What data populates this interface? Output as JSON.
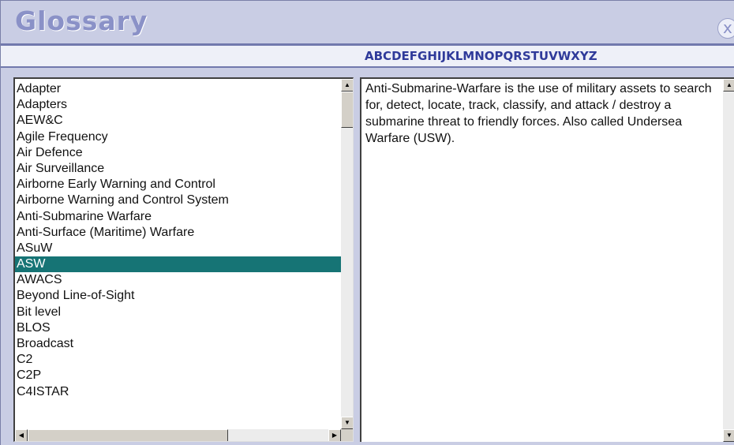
{
  "window": {
    "title": "Glossary",
    "close_glyph": "x",
    "accent_color": "#2f3a9a",
    "selected_color": "#167475"
  },
  "alphabet": [
    "A",
    "B",
    "C",
    "D",
    "E",
    "F",
    "G",
    "H",
    "I",
    "J",
    "K",
    "L",
    "M",
    "N",
    "O",
    "P",
    "Q",
    "R",
    "S",
    "T",
    "U",
    "V",
    "W",
    "X",
    "Y",
    "Z"
  ],
  "terms": [
    "Adapter",
    "Adapters",
    "AEW&C",
    "Agile Frequency",
    "Air Defence",
    "Air Surveillance",
    "Airborne Early Warning and Control",
    "Airborne Warning and Control System",
    "Anti-Submarine Warfare",
    "Anti-Surface (Maritime) Warfare",
    "ASuW",
    "ASW",
    "AWACS",
    "Beyond Line-of-Sight",
    "Bit level",
    "BLOS",
    "Broadcast",
    "C2",
    "C2P",
    "C4ISTAR"
  ],
  "selected_term": "ASW",
  "definition": "Anti-Submarine-Warfare is the use of military assets to search for, detect, locate, track, classify, and attack / destroy a submarine threat to friendly forces. Also called Undersea Warfare (USW).",
  "icons": {
    "close": "close-icon",
    "scroll_up": "arrow-up-icon",
    "scroll_down": "arrow-down-icon",
    "scroll_left": "arrow-left-icon",
    "scroll_right": "arrow-right-icon"
  }
}
